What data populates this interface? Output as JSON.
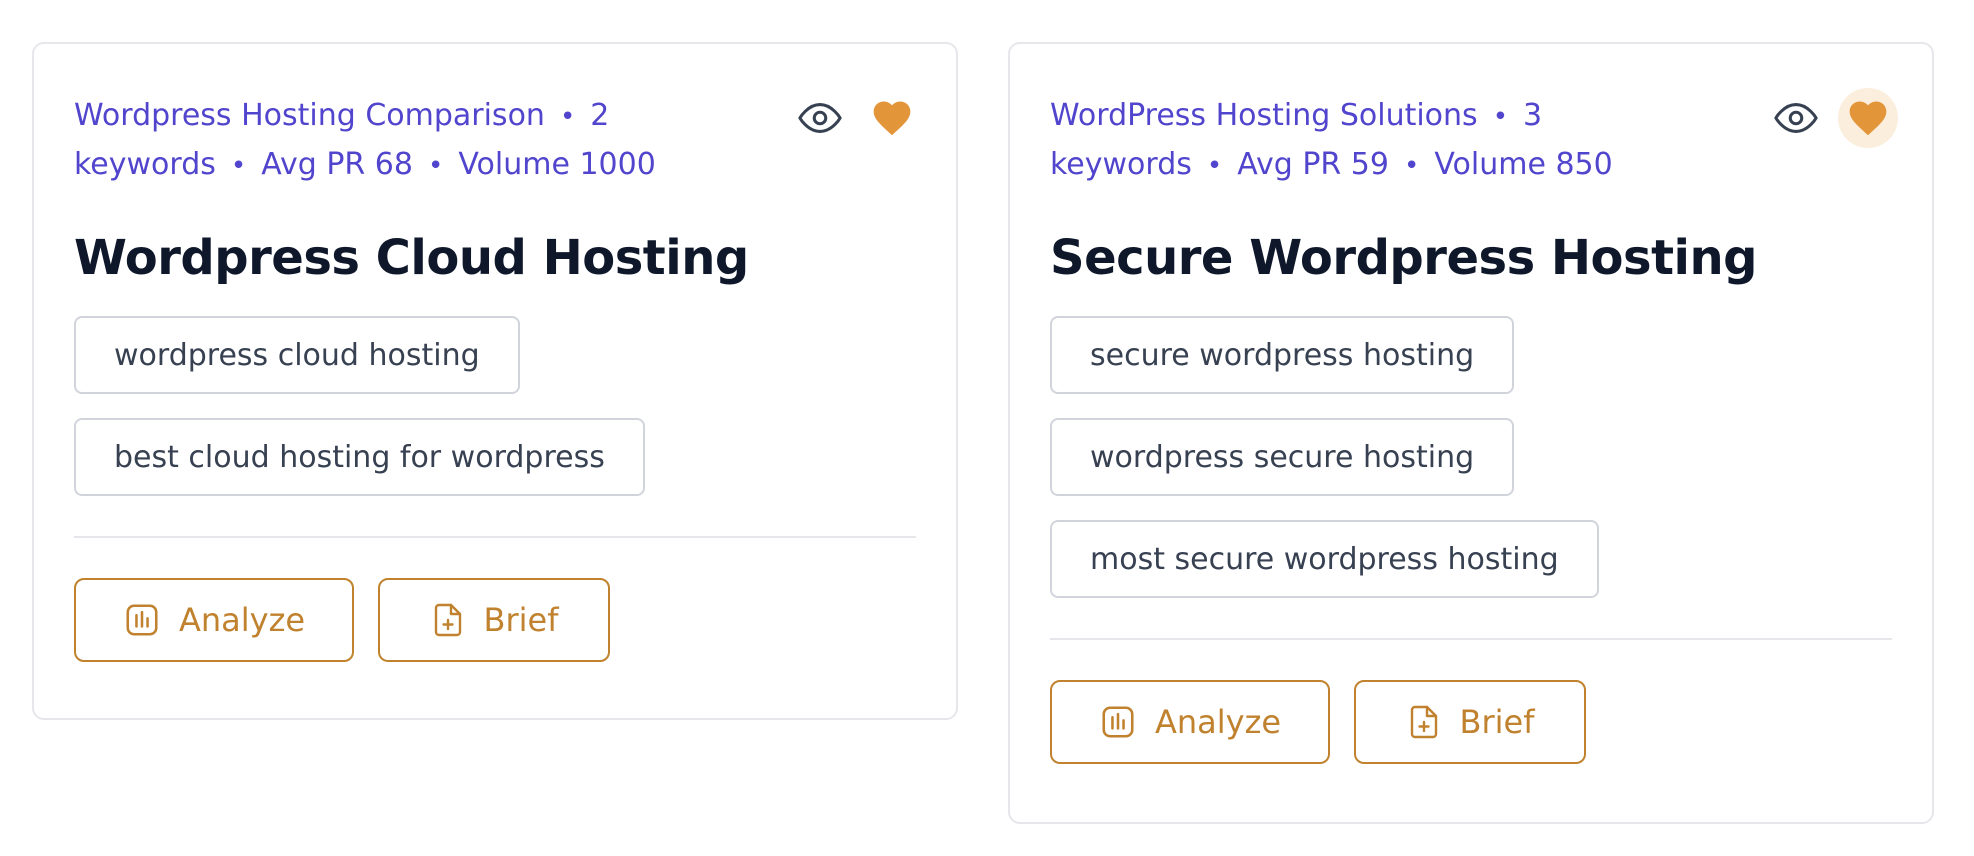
{
  "colors": {
    "accent": "#c0822e",
    "meta_text": "#5145cd",
    "heart": "#e3953a"
  },
  "cards": [
    {
      "meta": {
        "group": "Wordpress Hosting Comparison",
        "keywords": "2 keywords",
        "avg_pr": "Avg PR 68",
        "volume": "Volume 1000"
      },
      "title": "Wordpress Cloud Hosting",
      "keywords": [
        "wordpress cloud hosting",
        "best cloud hosting for wordpress"
      ],
      "analyze_label": "Analyze",
      "brief_label": "Brief",
      "icons": {
        "view": "eye-icon",
        "favorite": "heart-icon"
      }
    },
    {
      "meta": {
        "group": "WordPress Hosting Solutions",
        "keywords": "3 keywords",
        "avg_pr": "Avg PR 59",
        "volume": "Volume 850"
      },
      "title": "Secure Wordpress Hosting",
      "keywords": [
        "secure wordpress hosting",
        "wordpress secure hosting",
        "most secure wordpress hosting"
      ],
      "analyze_label": "Analyze",
      "brief_label": "Brief",
      "icons": {
        "view": "eye-icon",
        "favorite": "heart-icon"
      }
    }
  ]
}
